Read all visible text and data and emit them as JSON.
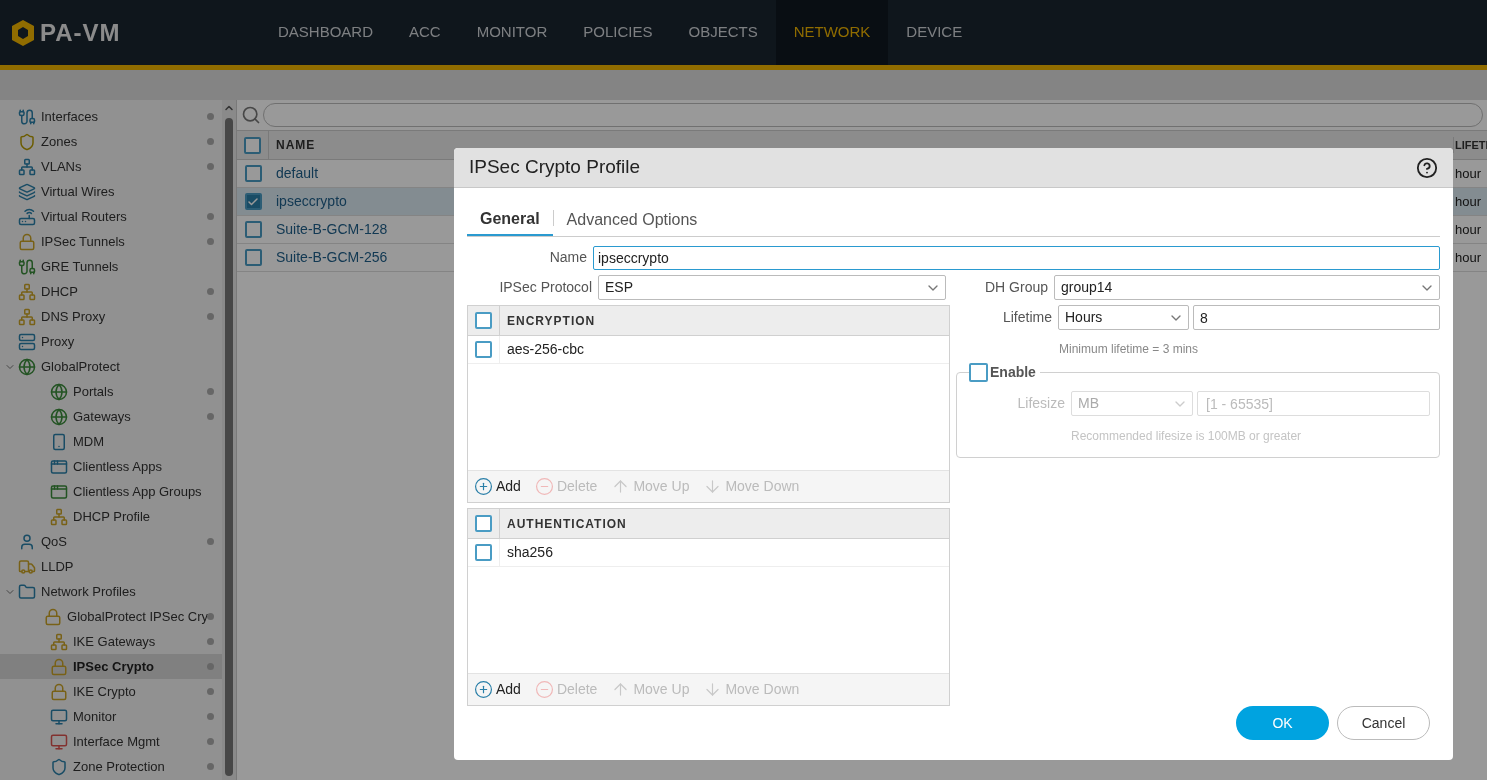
{
  "app": {
    "logo": "PA-VM"
  },
  "nav": [
    {
      "label": "DASHBOARD",
      "selected": false
    },
    {
      "label": "ACC",
      "selected": false
    },
    {
      "label": "MONITOR",
      "selected": false
    },
    {
      "label": "POLICIES",
      "selected": false
    },
    {
      "label": "OBJECTS",
      "selected": false
    },
    {
      "label": "NETWORK",
      "selected": true
    },
    {
      "label": "DEVICE",
      "selected": false
    }
  ],
  "sidebar": {
    "items": [
      {
        "label": "Interfaces",
        "dot": true,
        "selected": false
      },
      {
        "label": "Zones",
        "dot": true,
        "selected": false
      },
      {
        "label": "VLANs",
        "dot": true,
        "selected": false
      },
      {
        "label": "Virtual Wires",
        "dot": false,
        "selected": false
      },
      {
        "label": "Virtual Routers",
        "dot": true,
        "selected": false
      },
      {
        "label": "IPSec Tunnels",
        "dot": true,
        "selected": false
      },
      {
        "label": "GRE Tunnels",
        "dot": false,
        "selected": false
      },
      {
        "label": "DHCP",
        "dot": true,
        "selected": false
      },
      {
        "label": "DNS Proxy",
        "dot": true,
        "selected": false
      },
      {
        "label": "Proxy",
        "dot": false,
        "selected": false
      },
      {
        "label": "GlobalProtect",
        "dot": false,
        "selected": false,
        "expanded": true,
        "children": [
          {
            "label": "Portals",
            "dot": true,
            "selected": false
          },
          {
            "label": "Gateways",
            "dot": true,
            "selected": false
          },
          {
            "label": "MDM",
            "dot": false,
            "selected": false
          },
          {
            "label": "Clientless Apps",
            "dot": false,
            "selected": false
          },
          {
            "label": "Clientless App Groups",
            "dot": false,
            "selected": false
          },
          {
            "label": "DHCP Profile",
            "dot": false,
            "selected": false
          }
        ]
      },
      {
        "label": "QoS",
        "dot": true,
        "selected": false
      },
      {
        "label": "LLDP",
        "dot": false,
        "selected": false
      },
      {
        "label": "Network Profiles",
        "dot": false,
        "selected": false,
        "expanded": true,
        "children": [
          {
            "label": "GlobalProtect IPSec Cry",
            "dot": true,
            "selected": false
          },
          {
            "label": "IKE Gateways",
            "dot": true,
            "selected": false
          },
          {
            "label": "IPSec Crypto",
            "dot": true,
            "selected": true
          },
          {
            "label": "IKE Crypto",
            "dot": true,
            "selected": false
          },
          {
            "label": "Monitor",
            "dot": true,
            "selected": false
          },
          {
            "label": "Interface Mgmt",
            "dot": true,
            "selected": false
          },
          {
            "label": "Zone Protection",
            "dot": true,
            "selected": false
          }
        ]
      }
    ]
  },
  "table": {
    "columns": [
      "NAME",
      "LIFETI"
    ],
    "all_checked": false,
    "rows": [
      {
        "name": "default",
        "lifetime": "hour",
        "checked": false,
        "selected": false
      },
      {
        "name": "ipseccrypto",
        "lifetime": "hour",
        "checked": true,
        "selected": true
      },
      {
        "name": "Suite-B-GCM-128",
        "lifetime": "hour",
        "checked": false,
        "selected": false
      },
      {
        "name": "Suite-B-GCM-256",
        "lifetime": "hour",
        "checked": false,
        "selected": false
      }
    ]
  },
  "dialog": {
    "title": "IPSec Crypto Profile",
    "tabs": [
      {
        "label": "General",
        "selected": true
      },
      {
        "label": "Advanced Options",
        "selected": false
      }
    ],
    "name": {
      "label": "Name",
      "value": "ipseccrypto"
    },
    "protocol": {
      "label": "IPSec Protocol",
      "value": "ESP"
    },
    "lists": [
      {
        "header": "ENCRYPTION",
        "all_checked": false,
        "items": [
          {
            "label": "aes-256-cbc",
            "checked": false
          }
        ],
        "actions": [
          {
            "label": "Add",
            "disabled": false,
            "kind": "add"
          },
          {
            "label": "Delete",
            "disabled": true,
            "kind": "delete"
          },
          {
            "label": "Move Up",
            "disabled": true,
            "kind": "up"
          },
          {
            "label": "Move Down",
            "disabled": true,
            "kind": "down"
          }
        ]
      },
      {
        "header": "AUTHENTICATION",
        "all_checked": false,
        "items": [
          {
            "label": "sha256",
            "checked": false
          }
        ],
        "actions": [
          {
            "label": "Add",
            "disabled": false,
            "kind": "add"
          },
          {
            "label": "Delete",
            "disabled": true,
            "kind": "delete"
          },
          {
            "label": "Move Up",
            "disabled": true,
            "kind": "up"
          },
          {
            "label": "Move Down",
            "disabled": true,
            "kind": "down"
          }
        ]
      }
    ],
    "dh_group": {
      "label": "DH Group",
      "value": "group14"
    },
    "lifetime": {
      "label": "Lifetime",
      "unit": "Hours",
      "value": "8",
      "hint": "Minimum lifetime = 3 mins"
    },
    "lifesize": {
      "enable_label": "Enable",
      "enabled": false,
      "label": "Lifesize",
      "unit": "MB",
      "placeholder": "[1 - 65535]",
      "hint": "Recommended lifesize is 100MB or greater"
    },
    "buttons": [
      {
        "label": "OK",
        "kind": "primary"
      },
      {
        "label": "Cancel",
        "kind": "secondary"
      }
    ]
  }
}
